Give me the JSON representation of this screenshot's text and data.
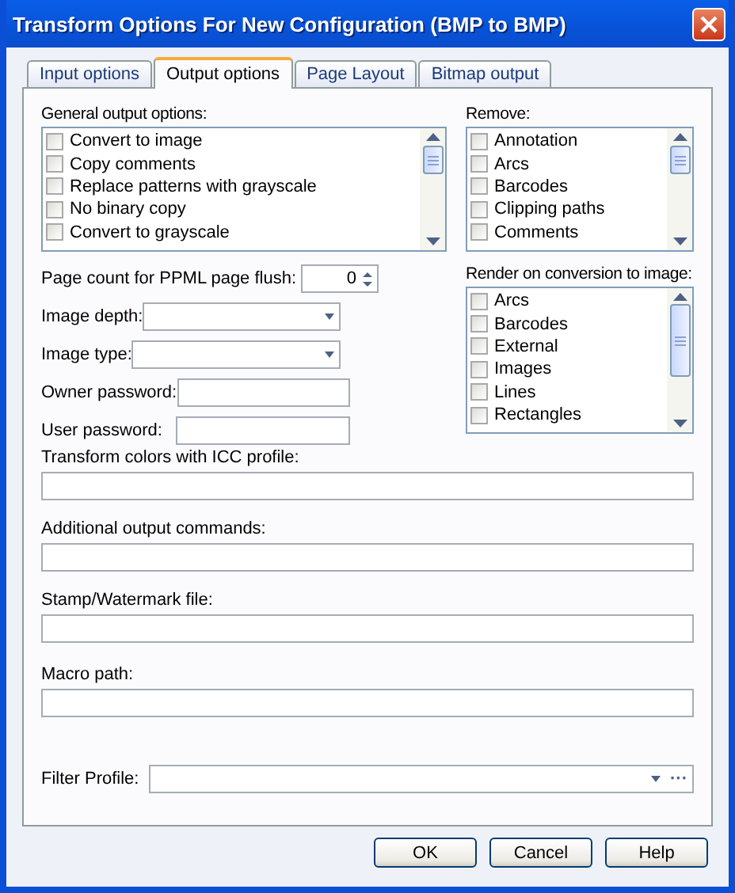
{
  "window": {
    "title": "Transform Options For New Configuration (BMP to BMP)"
  },
  "tabs": [
    {
      "label": "Input options",
      "selected": false
    },
    {
      "label": "Output options",
      "selected": true
    },
    {
      "label": "Page Layout",
      "selected": false
    },
    {
      "label": "Bitmap output",
      "selected": false
    }
  ],
  "general_output_options": {
    "label": "General output options:",
    "items": [
      {
        "label": "Convert to image",
        "checked": false
      },
      {
        "label": "Copy comments",
        "checked": false
      },
      {
        "label": "Replace patterns with grayscale",
        "checked": false
      },
      {
        "label": "No binary copy",
        "checked": false
      },
      {
        "label": "Convert to grayscale",
        "checked": false
      }
    ]
  },
  "remove": {
    "label": "Remove:",
    "items": [
      {
        "label": "Annotation",
        "checked": false
      },
      {
        "label": "Arcs",
        "checked": false
      },
      {
        "label": "Barcodes",
        "checked": false
      },
      {
        "label": "Clipping paths",
        "checked": false
      },
      {
        "label": "Comments",
        "checked": false
      }
    ]
  },
  "render_on_conversion": {
    "label": "Render on conversion to image:",
    "items": [
      {
        "label": "Arcs",
        "checked": false
      },
      {
        "label": "Barcodes",
        "checked": false
      },
      {
        "label": "External",
        "checked": false
      },
      {
        "label": "Images",
        "checked": false
      },
      {
        "label": "Lines",
        "checked": false
      },
      {
        "label": "Rectangles",
        "checked": false
      }
    ]
  },
  "left_fields": [
    {
      "kind": "spin",
      "label": "Page count for PPML page flush:",
      "value": "0"
    },
    {
      "kind": "dropdown",
      "label": "Image depth:"
    },
    {
      "kind": "dropdown",
      "label": "Image type:"
    },
    {
      "kind": "text",
      "label": "Owner password:"
    },
    {
      "kind": "text",
      "label": "User password:"
    }
  ],
  "wide_fields": [
    {
      "label": "Transform colors with ICC profile:"
    },
    {
      "label": "Additional output commands:"
    },
    {
      "label": "Stamp/Watermark file:"
    },
    {
      "label": "Macro path:"
    }
  ],
  "filter_profile": {
    "label": "Filter Profile:",
    "browse": "···"
  },
  "buttons": [
    "OK",
    "Cancel",
    "Help"
  ]
}
